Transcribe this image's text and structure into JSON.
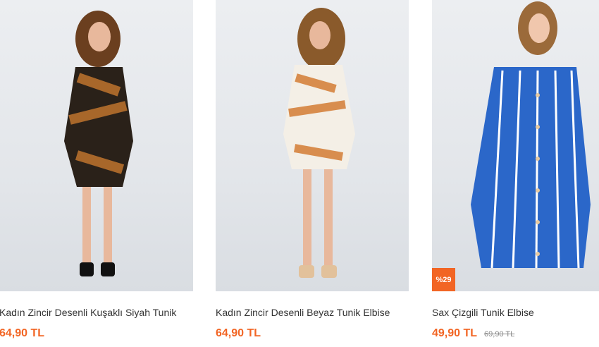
{
  "products": [
    {
      "title": "Kadın Zincir Desenli Kuşaklı Siyah Tunik",
      "price": "64,90 TL",
      "colors": {
        "dress": "#2a2119",
        "pattern": "#c8792e",
        "hair": "#6b3f1f",
        "skin": "#e8b89c",
        "shoes": "#111111"
      }
    },
    {
      "title": "Kadın Zincir Desenli Beyaz Tunik Elbise",
      "price": "64,90 TL",
      "colors": {
        "dress": "#f4efe6",
        "pattern": "#d27b33",
        "hair": "#8a5a2b",
        "skin": "#e8b89c",
        "shoes": "#e2c19b"
      }
    },
    {
      "title": "Sax Çizgili Tunik Elbise",
      "price": "49,90 TL",
      "old_price": "69,90 TL",
      "badge": "%29",
      "colors": {
        "dress": "#2b67c9",
        "pattern": "#ffffff",
        "hair": "#9b6a3a",
        "skin": "#f0c7ad",
        "shoes": "#000000"
      }
    }
  ],
  "accent": "#f26524"
}
